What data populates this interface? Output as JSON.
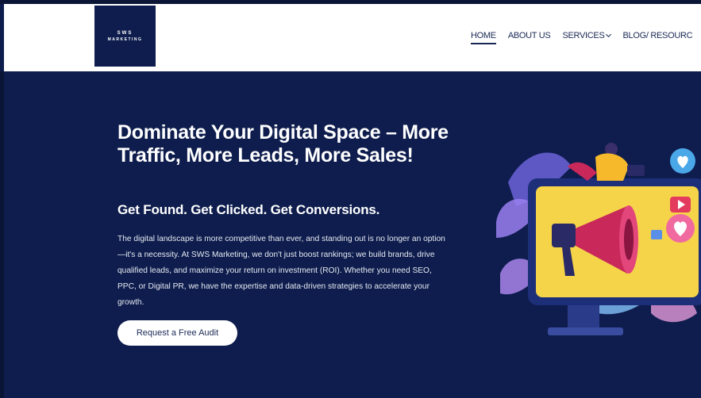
{
  "header": {
    "logo": {
      "line1": "SWS",
      "line2": "MARKETING"
    },
    "nav": [
      {
        "label": "HOME",
        "active": true
      },
      {
        "label": "ABOUT US",
        "active": false
      },
      {
        "label": "SERVICES",
        "active": false,
        "dropdown": true
      },
      {
        "label": "BLOG/ RESOURC",
        "active": false
      }
    ]
  },
  "hero": {
    "title": "Dominate Your Digital Space – More Traffic, More Leads, More Sales!",
    "subtitle": "Get Found. Get Clicked. Get Conversions.",
    "body": "The digital landscape is more competitive than ever, and standing out is no longer an option—it's a necessity. At SWS Marketing, we don't just boost rankings; we build brands, drive qualified leads, and maximize your return on investment (ROI). Whether you need SEO, PPC, or Digital PR, we have the expertise and data-driven strategies to accelerate your growth.",
    "cta_label": "Request a Free Audit"
  },
  "colors": {
    "navy": "#0e1d4d",
    "white": "#ffffff",
    "screen_yellow": "#f5d44a",
    "megaphone_red": "#c8285a",
    "heart_pink": "#f06aa0",
    "bubble_blue": "#4aa7e8"
  },
  "icons": [
    "megaphone-icon",
    "heart-icon",
    "play-icon",
    "monitor-icon"
  ]
}
